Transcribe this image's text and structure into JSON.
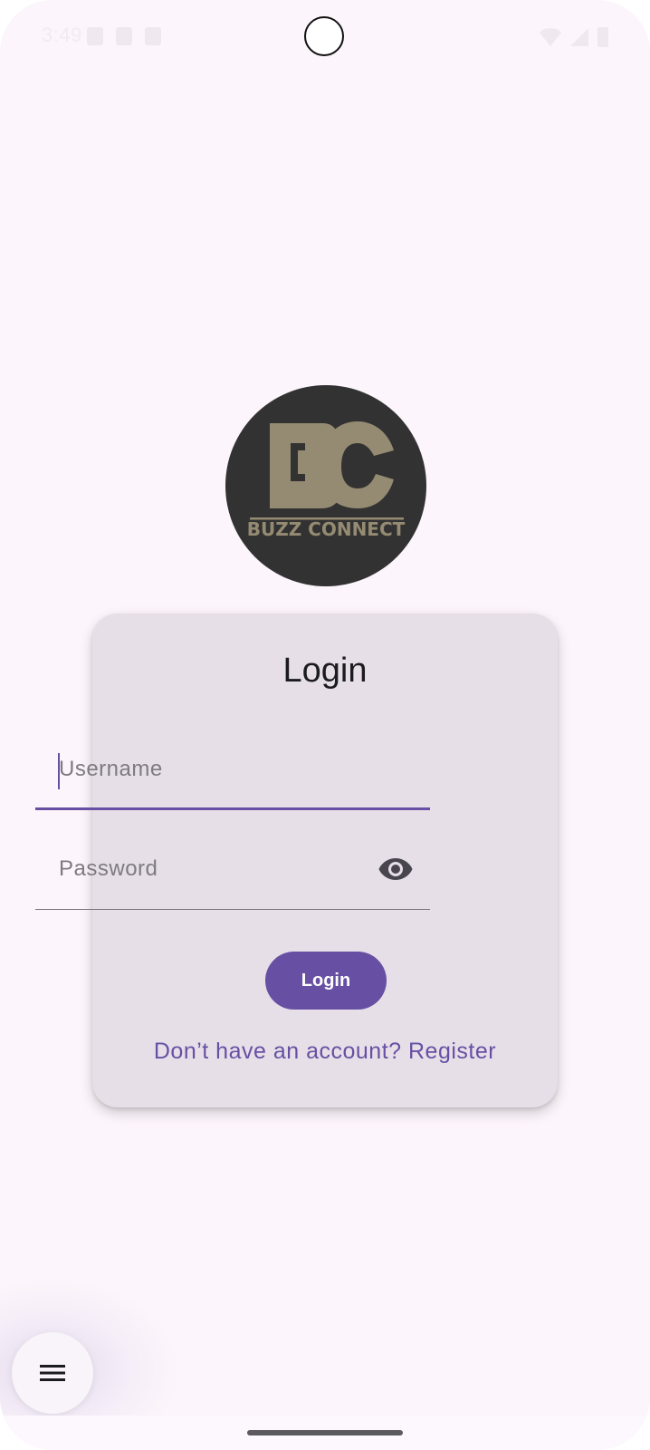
{
  "status_bar": {
    "time": "3:49",
    "icons": [
      "shield-icon",
      "sim-card-icon",
      "notification-icon",
      "wifi-icon",
      "signal-icon",
      "battery-icon"
    ]
  },
  "logo": {
    "text": "BC",
    "subtext": "BUZZ CONNECT",
    "colors": {
      "background": "#323232",
      "mark": "#958b72"
    }
  },
  "login_card": {
    "title": "Login",
    "username": {
      "placeholder": "Username",
      "value": ""
    },
    "password": {
      "placeholder": "Password",
      "value": "",
      "toggle_icon": "eye-icon"
    },
    "login_button": "Login",
    "register_link": "Don’t have an account? Register"
  },
  "fab": {
    "icon": "menu-icon"
  },
  "colors": {
    "primary": "#6750a4",
    "background": "#fcf5fb",
    "card": "#e6dfe7"
  }
}
